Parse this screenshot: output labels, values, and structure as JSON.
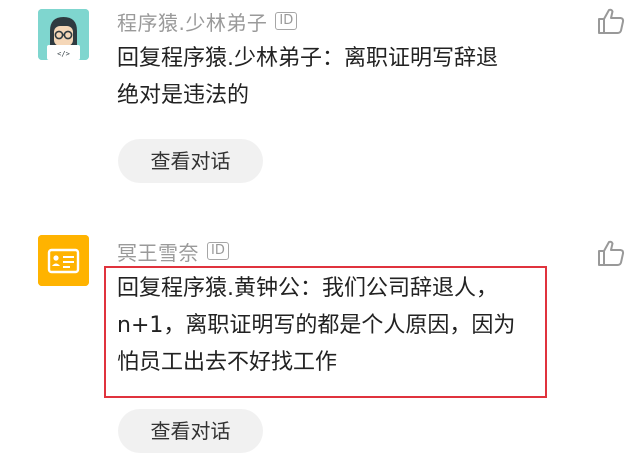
{
  "comments": [
    {
      "author": "程序猿.少林弟子",
      "badge": "ID",
      "text_line1": "回复程序猿.少林弟子：离职证明写辞退",
      "text_line2": "绝对是违法的",
      "button_label": "查看对话",
      "avatar_color": "#7fd6cf",
      "avatar_icon": "coder-avatar-icon"
    },
    {
      "author": "冥王雪奈",
      "badge": "ID",
      "text_line1": "回复程序猿.黄钟公：我们公司辞退人，",
      "text_line2": "n+1，离职证明写的都是个人原因，因为",
      "text_line3": "怕员工出去不好找工作",
      "button_label": "查看对话",
      "avatar_color": "#ffb300",
      "avatar_icon": "id-card-avatar-icon"
    }
  ],
  "colors": {
    "highlight_border": "#e0333d",
    "author_text": "#9a9a9a",
    "button_bg": "#f1f1f1"
  },
  "icons": {
    "like": "thumbs-up-icon"
  }
}
